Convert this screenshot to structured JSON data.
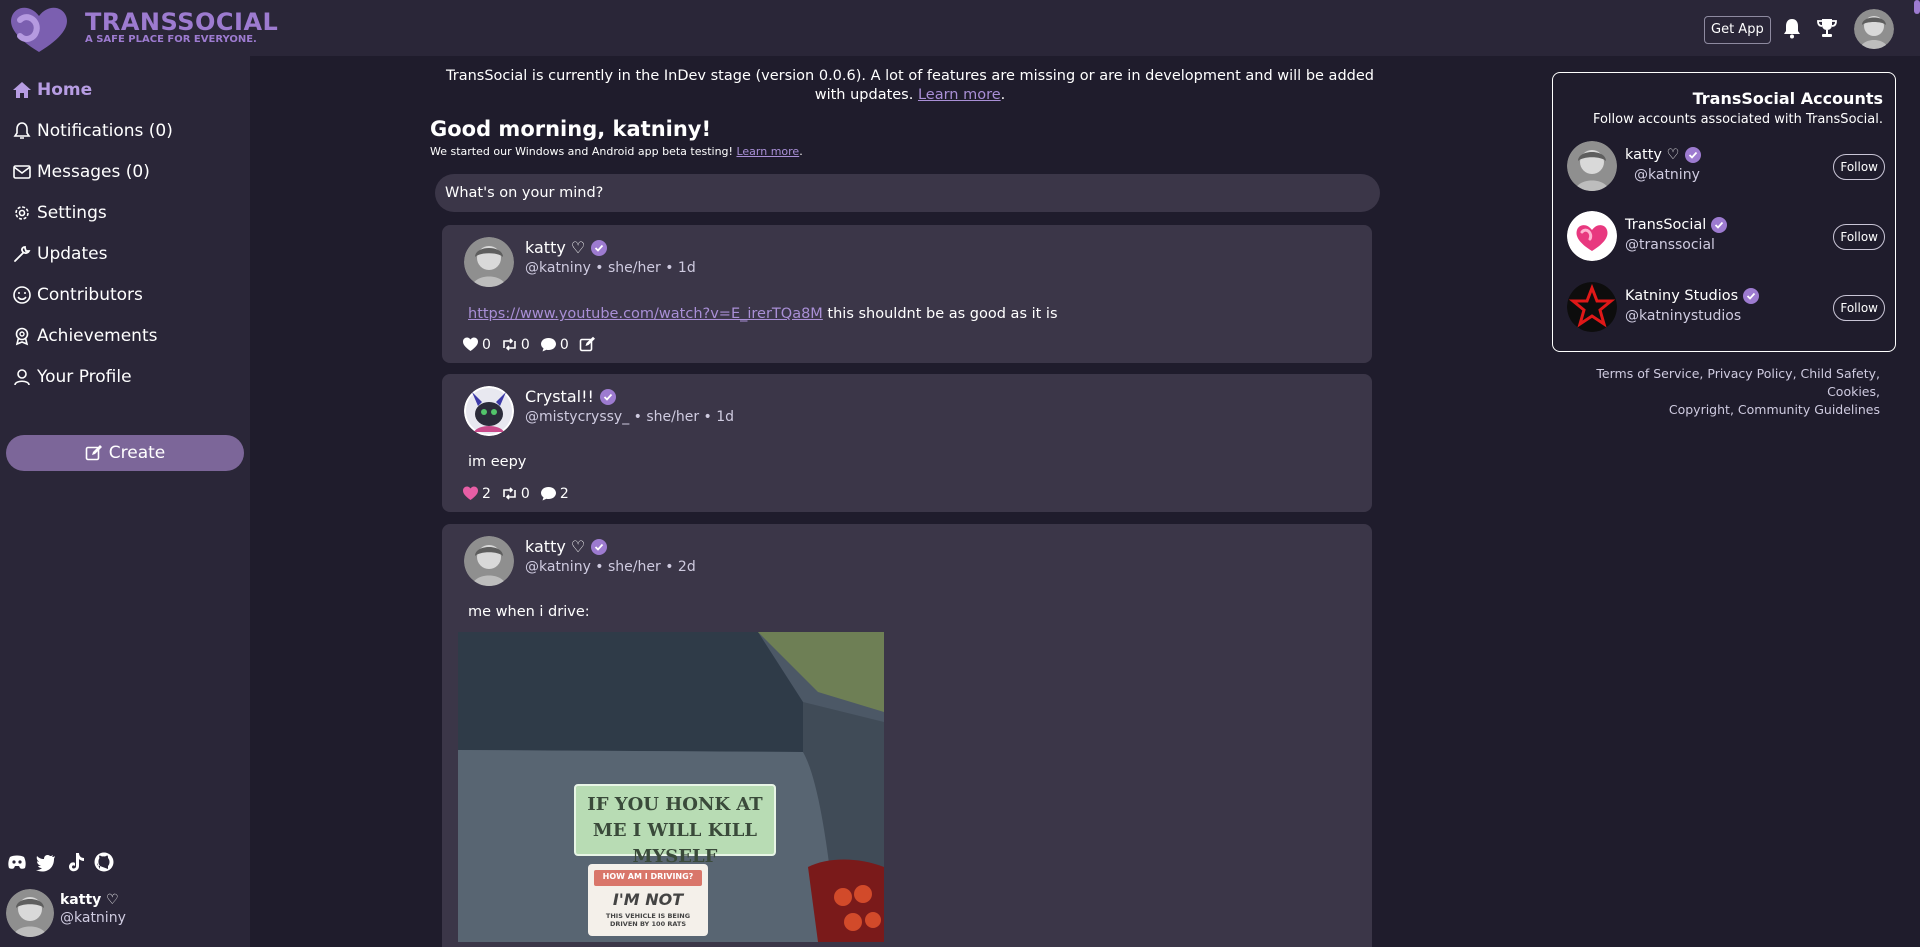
{
  "header": {
    "brand_name": "TRANSSOCIAL",
    "brand_tagline": "A SAFE PLACE FOR EVERYONE.",
    "get_app_label": "Get App",
    "accent_color": "#9d7bd0"
  },
  "sidebar": {
    "items": [
      {
        "label": "Home",
        "icon": "home-icon",
        "active": true
      },
      {
        "label": "Notifications (0)",
        "icon": "bell-icon"
      },
      {
        "label": "Messages (0)",
        "icon": "envelope-icon"
      },
      {
        "label": "Settings",
        "icon": "gear-icon"
      },
      {
        "label": "Updates",
        "icon": "wrench-icon"
      },
      {
        "label": "Contributors",
        "icon": "smile-icon"
      },
      {
        "label": "Achievements",
        "icon": "award-icon"
      },
      {
        "label": "Your Profile",
        "icon": "user-icon"
      }
    ],
    "create_label": "Create",
    "socials": [
      "discord-icon",
      "twitter-icon",
      "tiktok-icon",
      "github-icon"
    ],
    "me": {
      "name": "katty ♡",
      "handle": "@katniny"
    }
  },
  "main": {
    "notice_text": "TransSocial is currently in the InDev stage (version 0.0.6). A lot of features are missing or are in development and will be added with updates.",
    "notice_link": "Learn more",
    "greeting": "Good morning, katniny!",
    "beta_text": "We started our Windows and Android app beta testing!",
    "beta_link": "Learn more",
    "composer_placeholder": "What's on your mind?",
    "posts": [
      {
        "name": "katty ♡",
        "meta": "@katniny • she/her • 1d",
        "link": "https://www.youtube.com/watch?v=E_irerTQa8M",
        "text": "this shouldnt be as good as it is",
        "likes": "0",
        "reposts": "0",
        "comments": "0"
      },
      {
        "name": "Crystal!!",
        "meta": "@mistycryssy_ • she/her • 1d",
        "text": "im eepy",
        "likes": "2",
        "reposts": "0",
        "comments": "2"
      },
      {
        "name": "katty ♡",
        "meta": "@katniny • she/her • 2d",
        "text": "me when i drive:",
        "image": {
          "sticker_top": "IF YOU HONK AT ME I WILL KILL MYSELF",
          "sticker_bottom_header": "HOW AM I DRIVING?",
          "sticker_bottom_main": "I'M NOT",
          "sticker_bottom_sub": "THIS VEHICLE IS BEING DRIVEN BY 100 RATS"
        }
      }
    ]
  },
  "right": {
    "title": "TransSocial Accounts",
    "subtitle": "Follow accounts associated with TransSocial.",
    "accounts": [
      {
        "name": "katty ♡",
        "handle": "@katniny",
        "follow": "Follow"
      },
      {
        "name": "TransSocial",
        "handle": "@transsocial",
        "follow": "Follow"
      },
      {
        "name": "Katniny Studios",
        "handle": "@katninystudios",
        "follow": "Follow"
      }
    ],
    "footer": [
      "Terms of Service",
      "Privacy Policy",
      "Child Safety",
      "Cookies",
      "Copyright",
      "Community Guidelines"
    ]
  }
}
